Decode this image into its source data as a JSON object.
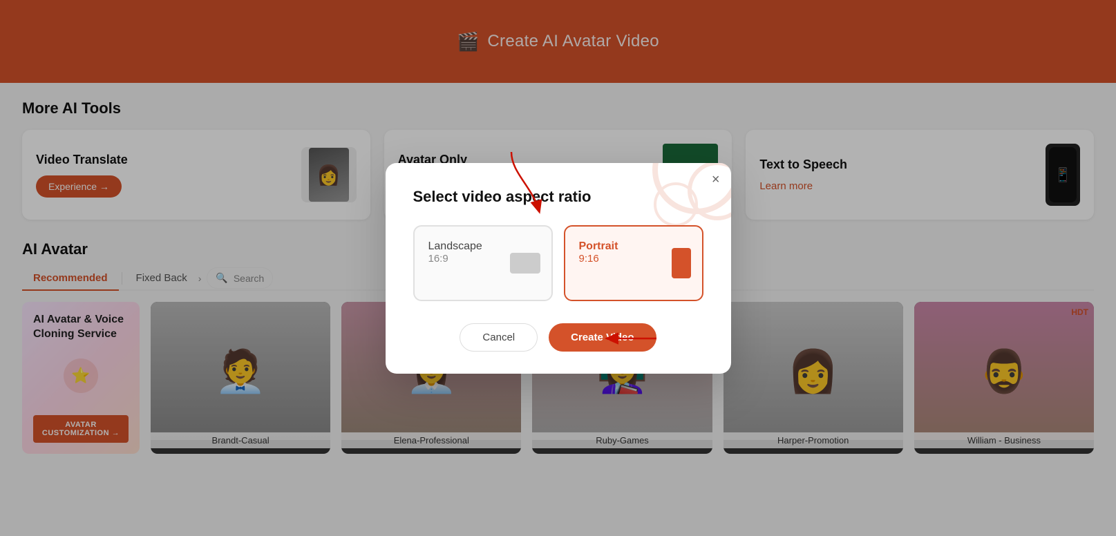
{
  "header": {
    "icon": "🎬",
    "title": "Create AI Avatar Video"
  },
  "sections": {
    "more_tools_title": "More AI Tools",
    "ai_avatar_title": "AI Avatar"
  },
  "tool_cards": [
    {
      "id": "video-translate",
      "title": "Video Translate",
      "cta": "Experience →"
    },
    {
      "id": "avatar-only",
      "title": "Avatar Only"
    },
    {
      "id": "text-to-speech",
      "title": "Text to Speech",
      "link": "Learn more"
    }
  ],
  "avatar_tabs": [
    {
      "label": "Recommended",
      "active": true
    },
    {
      "label": "Fixed Back",
      "active": false
    }
  ],
  "search_placeholder": "Search",
  "avatar_names": [
    "AI Avatar & Voice Cloning Service",
    "Brandt-Casual",
    "Elena-Professional",
    "Ruby-Games",
    "Harper-Promotion",
    "William - Business"
  ],
  "avatar_cta": "AVATAR CUSTOMIZATION →",
  "hdt_badge": "HDT",
  "modal": {
    "title": "Select video aspect ratio",
    "close_label": "×",
    "options": [
      {
        "id": "landscape",
        "label": "Landscape",
        "ratio": "16:9",
        "selected": false,
        "icon_type": "landscape"
      },
      {
        "id": "portrait",
        "label": "Portrait",
        "ratio": "9:16",
        "selected": true,
        "icon_type": "portrait"
      }
    ],
    "cancel_label": "Cancel",
    "create_label": "Create Video"
  }
}
